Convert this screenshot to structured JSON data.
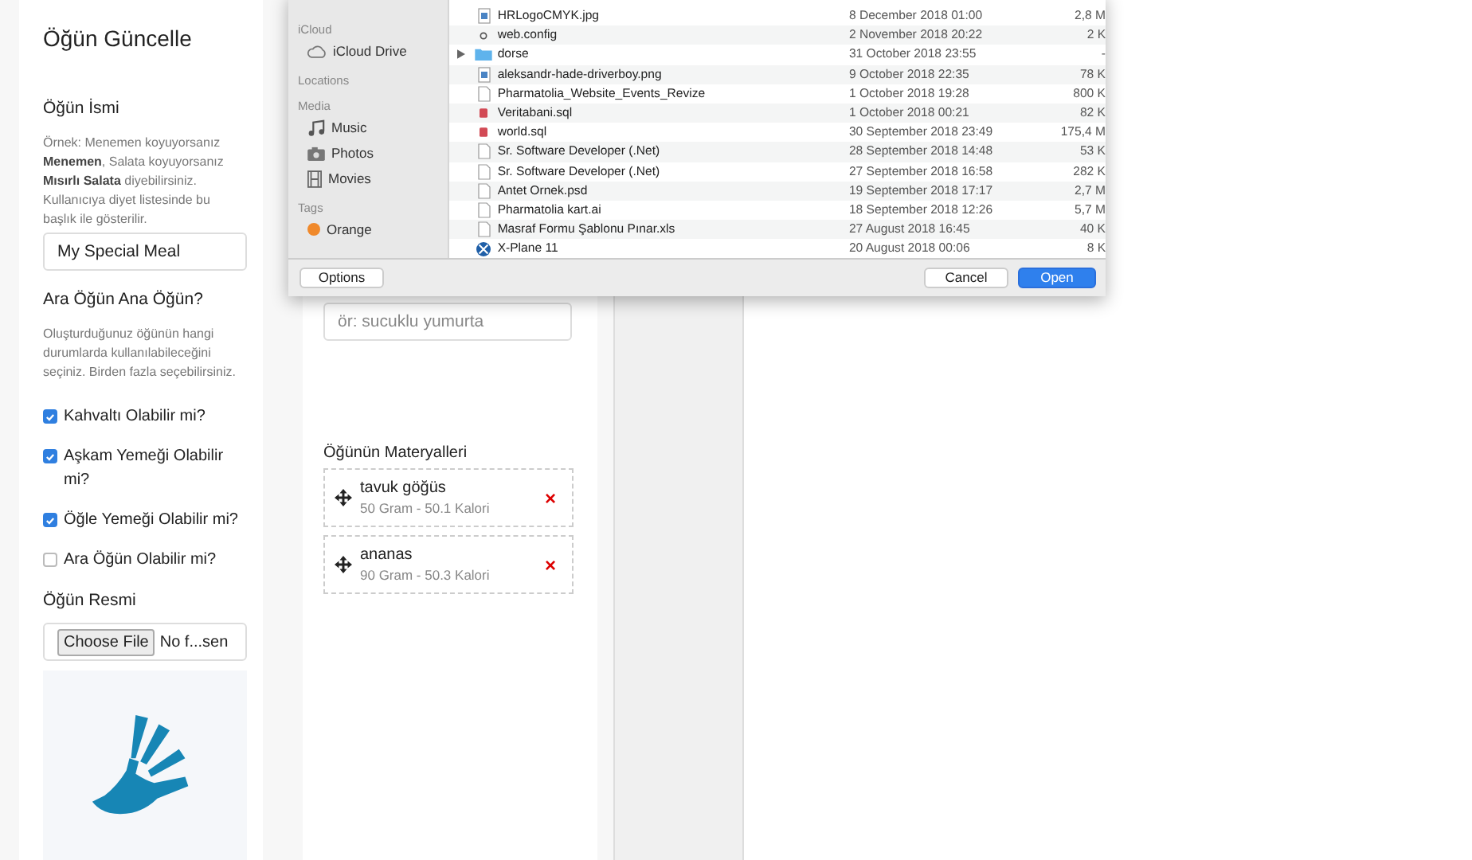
{
  "meal_form": {
    "title": "Öğün Güncelle",
    "name_label": "Öğün İsmi",
    "name_help": "Örnek: Menemen koyuyorsanız **Menemen**, Salata koyuyorsanız **Mısırlı Salata** diyebilirsiniz. Kullanıcıya diyet listesinde bu başlık ile gösterilir.",
    "name_value": "My Special Meal",
    "type_label": "Ara Öğün Ana Öğün?",
    "type_help": "Oluşturduğunuz öğünün hangi durumlarda kullanılabileceğini seçiniz. Birden fazla seçebilirsiniz.",
    "options": [
      {
        "label": "Kahvaltı Olabilir mi?",
        "checked": true
      },
      {
        "label": "Aşkam Yemeği Olabilir mi?",
        "checked": true
      },
      {
        "label": "Öğle Yemeği Olabilir mi?",
        "checked": true
      },
      {
        "label": "Ara Öğün Olabilir mi?",
        "checked": false
      }
    ],
    "image_label": "Öğün Resmi",
    "file_button": "Choose File",
    "file_status": "No f...sen"
  },
  "ingredients": {
    "search": {
      "placeholder": "ör: sucuklu yumurta"
    },
    "heading": "Öğünün Materyalleri",
    "items": [
      {
        "name": "tavuk göğüs",
        "detail": "50 Gram - 50.1 Kalori",
        "remove": "×"
      },
      {
        "name": "ananas",
        "detail": "90 Gram - 50.3 Kalori",
        "remove": "×"
      }
    ]
  },
  "file_dialog": {
    "sidebar": [
      {
        "heading": "iCloud",
        "items": [
          {
            "label": "iCloud Drive",
            "kind": "cloud"
          }
        ]
      },
      {
        "heading": "Locations"
      },
      {
        "heading": "Media",
        "items": [
          {
            "label": "Music",
            "kind": "music"
          },
          {
            "label": "Photos",
            "kind": "photos"
          },
          {
            "label": "Movies",
            "kind": "movies"
          }
        ]
      },
      {
        "heading": "Tags",
        "items": [
          {
            "label": "Orange",
            "kind": "tag",
            "color": "#f0892b"
          }
        ]
      }
    ],
    "files": [
      {
        "name": "HRLogoCMYK.jpg",
        "date": "8 December 2018 01:00",
        "size": "2,8 M",
        "kind": "image"
      },
      {
        "name": "web.config",
        "date": "2 November 2018 20:22",
        "size": "2 K",
        "kind": "config"
      },
      {
        "name": "dorse",
        "date": "31 October 2018 23:55",
        "size": "-",
        "kind": "folder"
      },
      {
        "name": "aleksandr-hade-driverboy.png",
        "date": "9 October 2018 22:35",
        "size": "78 K",
        "kind": "image"
      },
      {
        "name": "Pharmatolia_Website_Events_Revize",
        "date": "1 October 2018 19:28",
        "size": "800 K",
        "kind": "document"
      },
      {
        "name": "Veritabani.sql",
        "date": "1 October 2018 00:21",
        "size": "82 K",
        "kind": "sql"
      },
      {
        "name": "world.sql",
        "date": "30 September 2018 23:49",
        "size": "175,4 M",
        "kind": "sql"
      },
      {
        "name": "Sr. Software Developer (.Net)",
        "date": "28 September 2018 14:48",
        "size": "53 K",
        "kind": "document"
      },
      {
        "name": "Sr. Software Developer (.Net)",
        "date": "27 September 2018 16:58",
        "size": "282 K",
        "kind": "document"
      },
      {
        "name": "Antet Ornek.psd",
        "date": "19 September 2018 17:17",
        "size": "2,7 M",
        "kind": "document"
      },
      {
        "name": "Pharmatolia kart.ai",
        "date": "18 September 2018 12:26",
        "size": "5,7 M",
        "kind": "document"
      },
      {
        "name": "Masraf Formu Şablonu Pınar.xls",
        "date": "27 August 2018 16:45",
        "size": "40 K",
        "kind": "document"
      },
      {
        "name": "X-Plane 11",
        "date": "20 August 2018 00:06",
        "size": "8 K",
        "kind": "app"
      }
    ],
    "buttons": {
      "options": "Options",
      "cancel": "Cancel",
      "open": "Open"
    }
  }
}
